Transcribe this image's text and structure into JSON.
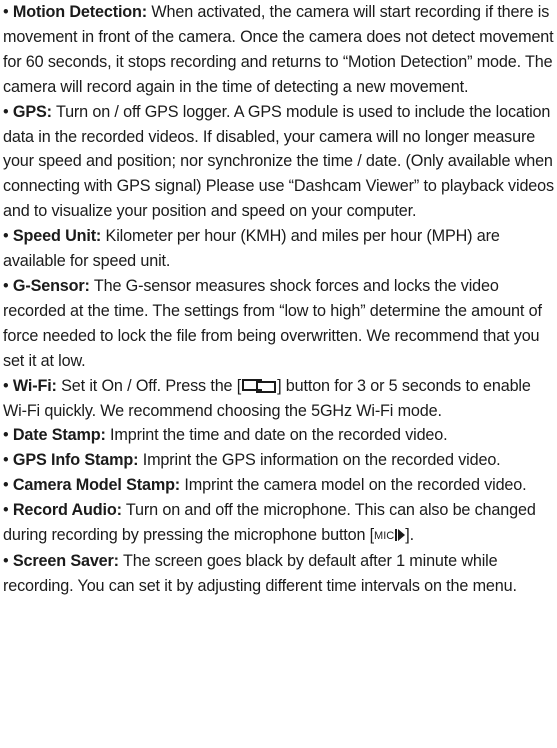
{
  "bullet": "•",
  "items": [
    {
      "term": "Motion Detection:",
      "text": "When activated, the camera will start recording if there is movement in front of the camera. Once the camera does not detect movement for 60 seconds, it stops recording and returns to “Motion Detection” mode. The camera will record again in the time of detecting a new movement."
    },
    {
      "term": "GPS:",
      "text": "Turn on / off GPS logger. A GPS module is used to include the location data in the recorded videos. If disabled, your camera will no longer measure your speed and position; nor synchronize the time / date. (Only available when connecting with GPS signal) Please use “Dashcam Viewer” to playback videos and to visualize your position and speed on your computer."
    },
    {
      "term": "Speed Unit:",
      "text": "Kilometer per hour (KMH) and miles per hour (MPH) are available for speed unit."
    },
    {
      "term": "G-Sensor:",
      "text": "The G-sensor measures shock forces and locks the video recorded at the time. The settings from “low to high” determine the amount of force needed to lock the file from being overwritten. We recommend that you set it at low."
    },
    {
      "term": "Wi-Fi:",
      "text_before": "Set it On / Off. Press the [",
      "icon": "dual-screen-button-icon",
      "text_after": "] button for 3 or 5 seconds to enable Wi-Fi quickly. We recommend choosing the 5GHz Wi-Fi mode."
    },
    {
      "term": "Date Stamp:",
      "text": "Imprint the time and date on the recorded video."
    },
    {
      "term": "GPS Info Stamp:",
      "text": "Imprint the GPS information on the recorded video."
    },
    {
      "term": "Camera Model Stamp:",
      "text": "Imprint the camera model on the recorded video."
    },
    {
      "term": "Record Audio:",
      "text_before": "Turn on and off the microphone. This can also be changed during recording by pressing the microphone button [",
      "mic_label": "MIC",
      "icon": "play-pause-icon",
      "text_after": "]."
    },
    {
      "term": "Screen Saver:",
      "text": "The screen goes black by default after 1 minute while recording. You can set it by adjusting different time intervals on the menu."
    }
  ]
}
